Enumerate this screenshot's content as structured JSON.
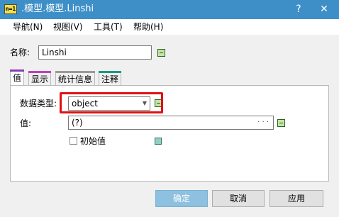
{
  "window": {
    "app_icon_text": "n=1",
    "title": ".模型.模型.Linshi",
    "help_button": "?",
    "close_button": "✕"
  },
  "menu": {
    "items": [
      {
        "label": "导航(N)"
      },
      {
        "label": "视图(V)"
      },
      {
        "label": "工具(T)"
      },
      {
        "label": "帮助(H)"
      }
    ]
  },
  "name_field": {
    "label": "名称:",
    "value": "Linshi"
  },
  "tabs": [
    {
      "label": "值",
      "accent": "#8a3fb4",
      "active": true
    },
    {
      "label": "显示",
      "accent": "#c040c0",
      "active": false
    },
    {
      "label": "统计信息",
      "accent": "#9a9a9a",
      "active": false
    },
    {
      "label": "注释",
      "accent": "#1a9a80",
      "active": false
    }
  ],
  "value_tab": {
    "data_type_label": "数据类型:",
    "data_type_selected": "object",
    "value_label": "值:",
    "value_text": "(?)",
    "value_ellipsis": "· · ·",
    "initial_value_label": "初始值",
    "initial_value_checked": false
  },
  "buttons": {
    "ok": "确定",
    "cancel": "取消",
    "apply": "应用"
  },
  "colors": {
    "titlebar": "#3e8fc8",
    "highlight": "#e01010",
    "primary_button": "#8ec1df"
  }
}
